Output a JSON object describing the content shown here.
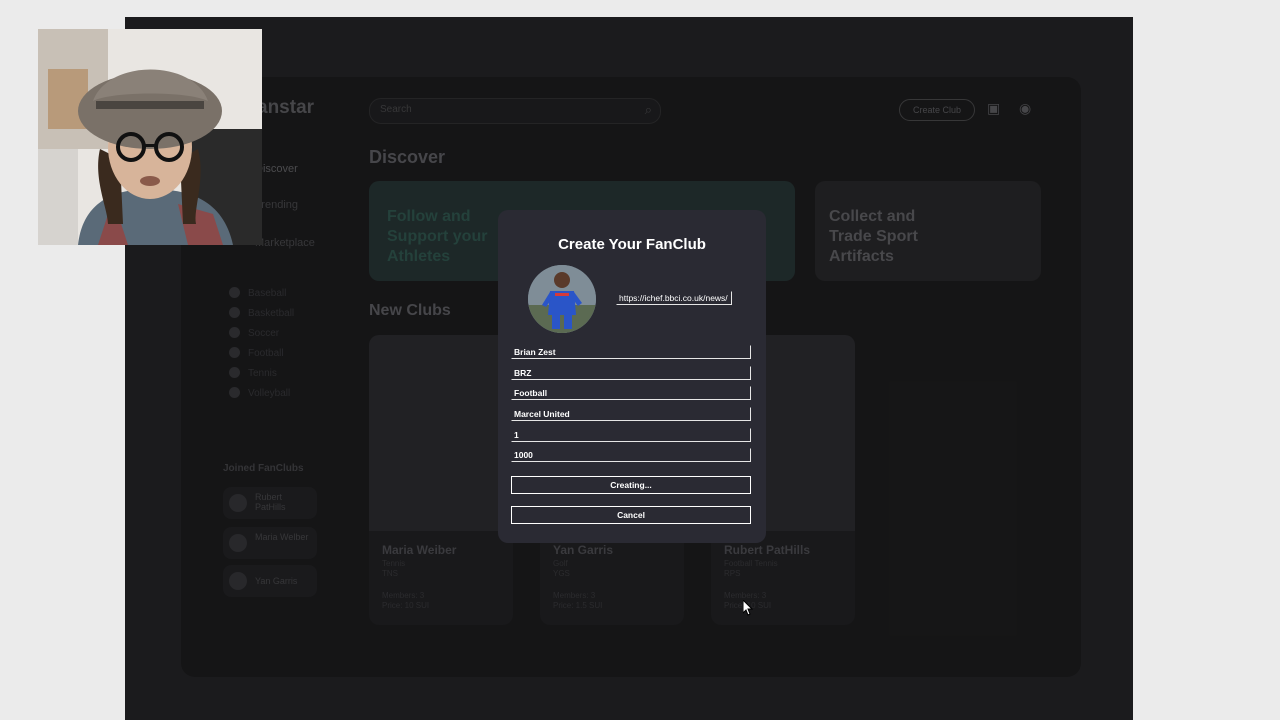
{
  "app": {
    "brand": "anstar",
    "search_placeholder": "Search",
    "create_club_label": "Create Club"
  },
  "sidebar": {
    "items": [
      {
        "label": "Discover"
      },
      {
        "label": "Trending"
      },
      {
        "label": "Marketplace"
      }
    ],
    "sports": [
      {
        "label": "Baseball"
      },
      {
        "label": "Basketball"
      },
      {
        "label": "Soccer"
      },
      {
        "label": "Football"
      },
      {
        "label": "Tennis"
      },
      {
        "label": "Volleyball"
      }
    ],
    "joined_title": "Joined FanClubs",
    "joined": [
      {
        "label": "Rubert PatHills"
      },
      {
        "label": "Maria Welber"
      },
      {
        "label": "Yan Garris"
      }
    ]
  },
  "main": {
    "discover_title": "Discover",
    "banners": [
      {
        "text": "Follow and\nSupport your\nAthletes"
      },
      {
        "text": "Collect and\nTrade Sport\nArtifacts"
      }
    ],
    "new_clubs_title": "New Clubs",
    "cards": [
      {
        "name": "Maria Weiber",
        "sport": "Tennis",
        "sub": "TNS",
        "members": "Members: 3",
        "price": "Price: 10 SUI"
      },
      {
        "name": "Yan Garris",
        "sport": "Golf",
        "sub": "YGS",
        "members": "Members: 3",
        "price": "Price: 1.5 SUI"
      },
      {
        "name": "Rubert PatHills",
        "sport": "Football Tennis",
        "sub": "RPS",
        "members": "Members: 3",
        "price": "Price: 10 SUI"
      }
    ]
  },
  "modal": {
    "title": "Create Your FanClub",
    "image_url": "https://ichef.bbci.co.uk/news/",
    "fields": [
      {
        "value": "Brian Zest"
      },
      {
        "value": "BRZ"
      },
      {
        "value": "Football"
      },
      {
        "value": "Marcel United"
      },
      {
        "value": "1"
      },
      {
        "value": "1000"
      }
    ],
    "submit_label": "Creating...",
    "cancel_label": "Cancel"
  },
  "icons": {
    "search": "search-icon",
    "wallet": "wallet-icon",
    "profile": "profile-icon",
    "cursor": "mouse-pointer-icon"
  },
  "colors": {
    "modal_bg": "#2a2a33",
    "app_bg": "#171718",
    "banner_teal": "#1f2b2b"
  }
}
